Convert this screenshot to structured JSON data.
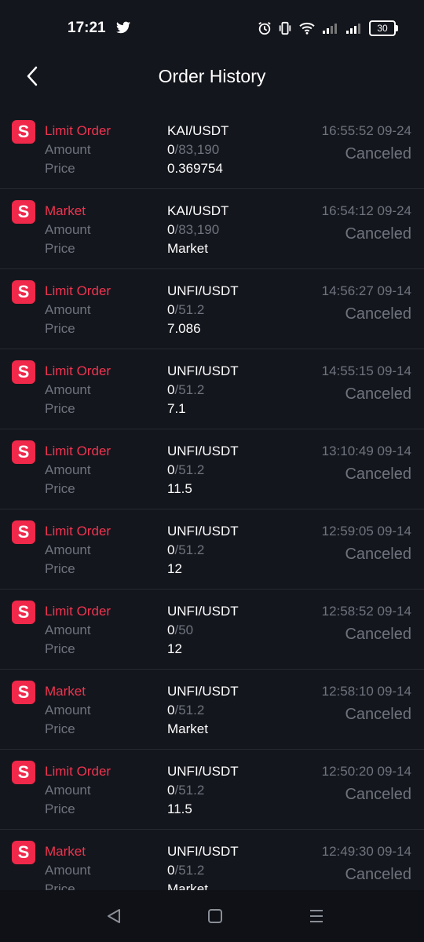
{
  "status_bar": {
    "time": "17:21",
    "battery": "30"
  },
  "header": {
    "title": "Order History"
  },
  "labels": {
    "amount": "Amount",
    "price": "Price"
  },
  "orders": [
    {
      "badge": "S",
      "type": "Limit Order",
      "pair": "KAI/USDT",
      "filled": "0",
      "total": "/83,190",
      "price": "0.369754",
      "time": "16:55:52 09-24",
      "status": "Canceled"
    },
    {
      "badge": "S",
      "type": "Market",
      "pair": "KAI/USDT",
      "filled": "0",
      "total": "/83,190",
      "price": "Market",
      "time": "16:54:12 09-24",
      "status": "Canceled"
    },
    {
      "badge": "S",
      "type": "Limit Order",
      "pair": "UNFI/USDT",
      "filled": "0",
      "total": "/51.2",
      "price": "7.086",
      "time": "14:56:27 09-14",
      "status": "Canceled"
    },
    {
      "badge": "S",
      "type": "Limit Order",
      "pair": "UNFI/USDT",
      "filled": "0",
      "total": "/51.2",
      "price": "7.1",
      "time": "14:55:15 09-14",
      "status": "Canceled"
    },
    {
      "badge": "S",
      "type": "Limit Order",
      "pair": "UNFI/USDT",
      "filled": "0",
      "total": "/51.2",
      "price": "11.5",
      "time": "13:10:49 09-14",
      "status": "Canceled"
    },
    {
      "badge": "S",
      "type": "Limit Order",
      "pair": "UNFI/USDT",
      "filled": "0",
      "total": "/51.2",
      "price": "12",
      "time": "12:59:05 09-14",
      "status": "Canceled"
    },
    {
      "badge": "S",
      "type": "Limit Order",
      "pair": "UNFI/USDT",
      "filled": "0",
      "total": "/50",
      "price": "12",
      "time": "12:58:52 09-14",
      "status": "Canceled"
    },
    {
      "badge": "S",
      "type": "Market",
      "pair": "UNFI/USDT",
      "filled": "0",
      "total": "/51.2",
      "price": "Market",
      "time": "12:58:10 09-14",
      "status": "Canceled"
    },
    {
      "badge": "S",
      "type": "Limit Order",
      "pair": "UNFI/USDT",
      "filled": "0",
      "total": "/51.2",
      "price": "11.5",
      "time": "12:50:20 09-14",
      "status": "Canceled"
    },
    {
      "badge": "S",
      "type": "Market",
      "pair": "UNFI/USDT",
      "filled": "0",
      "total": "/51.2",
      "price": "Market",
      "time": "12:49:30 09-14",
      "status": "Canceled"
    }
  ],
  "colors": {
    "background": "#14161d",
    "sell_red": "#f0344f",
    "badge_red": "#f0284a",
    "muted": "#6e737d"
  },
  "icons": {
    "status": [
      "twitter-icon",
      "alarm-icon",
      "vibrate-icon",
      "wifi-icon",
      "signal-icon",
      "battery-icon"
    ],
    "back": "chevron-left-icon",
    "nav": [
      "nav-back-icon",
      "nav-home-icon",
      "nav-menu-icon"
    ]
  }
}
